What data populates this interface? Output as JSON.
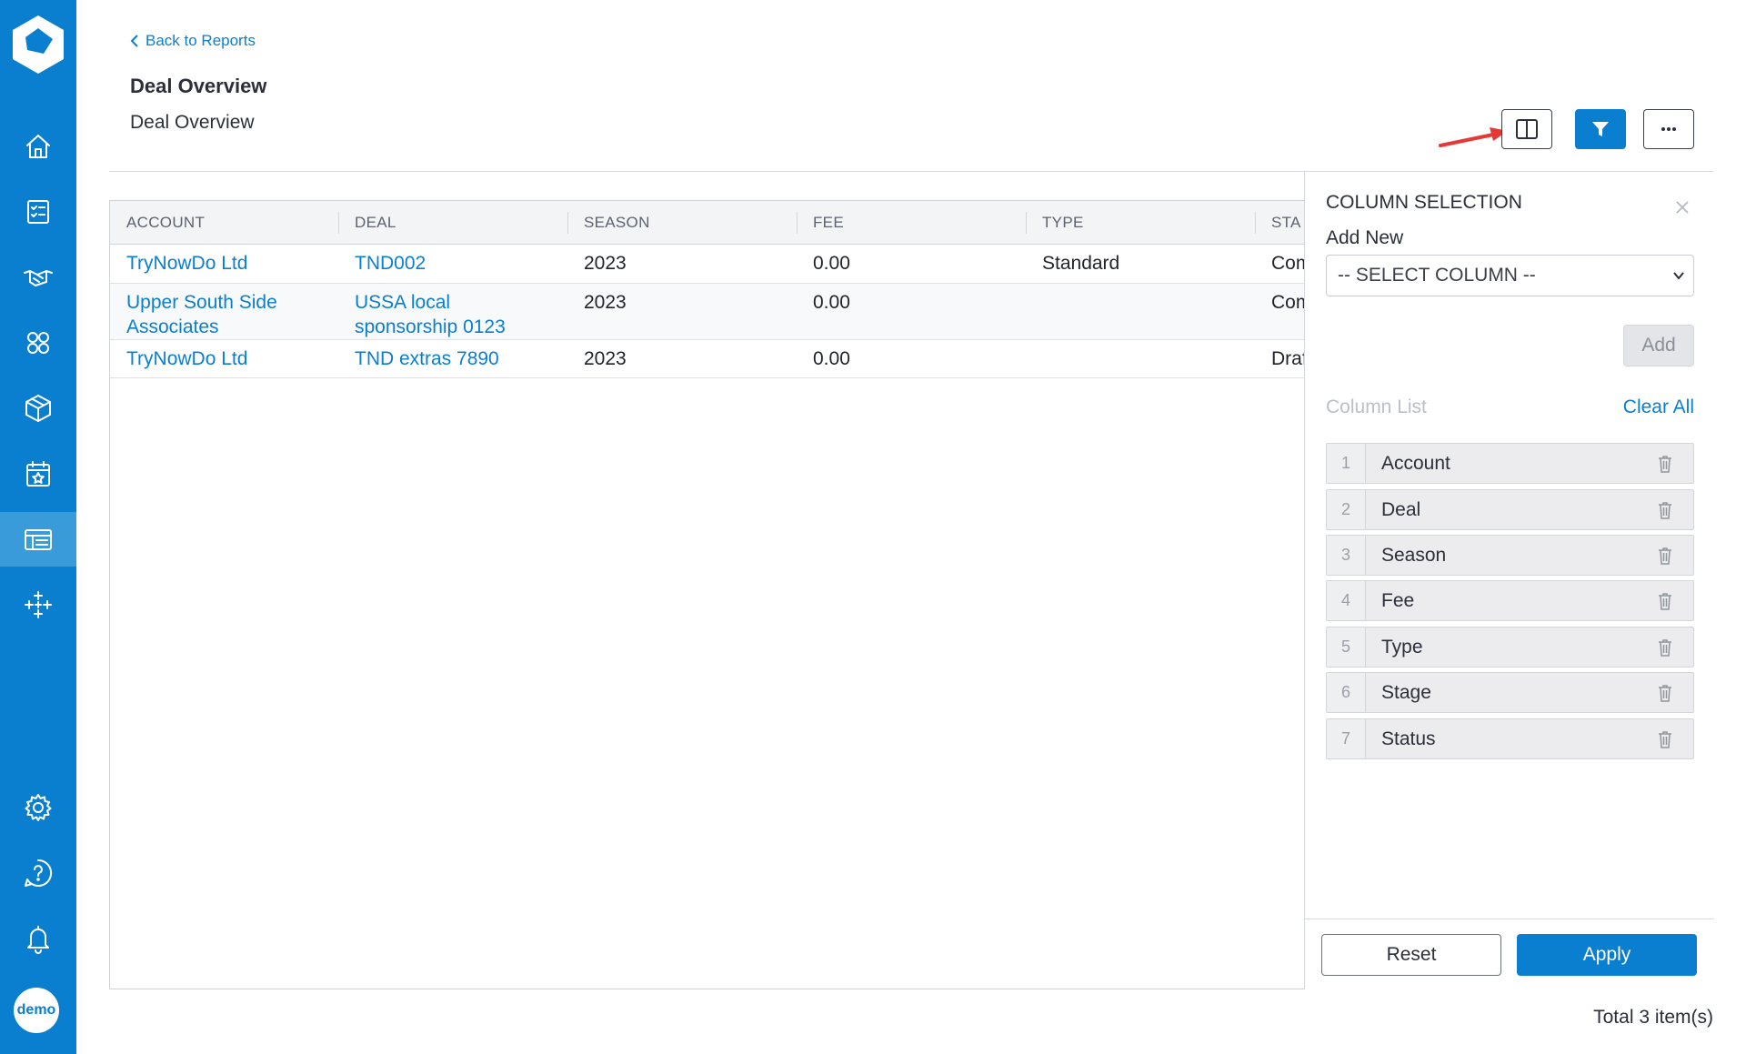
{
  "nav": {
    "items": [
      {
        "icon": "home-icon"
      },
      {
        "icon": "checklist-icon"
      },
      {
        "icon": "handshake-icon"
      },
      {
        "icon": "users-icon"
      },
      {
        "icon": "package-icon"
      },
      {
        "icon": "calendar-star-icon"
      },
      {
        "icon": "reports-icon",
        "active": true
      },
      {
        "icon": "sparkle-grid-icon"
      },
      {
        "icon": "gear-icon"
      },
      {
        "icon": "help-icon"
      },
      {
        "icon": "bell-icon"
      }
    ],
    "avatar_label": "demo"
  },
  "header": {
    "back_label": "Back to Reports",
    "title": "Deal Overview",
    "subtitle": "Deal Overview"
  },
  "toolbar": {
    "columns_icon": "columns-icon",
    "filter_icon": "filter-icon",
    "more_icon": "more-icon"
  },
  "table": {
    "columns": [
      "ACCOUNT",
      "DEAL",
      "SEASON",
      "FEE",
      "TYPE",
      "STA"
    ],
    "rows": [
      {
        "account": "TryNowDo Ltd",
        "deal": "TND002",
        "season": "2023",
        "fee": "0.00",
        "type": "Standard",
        "stage": "Com"
      },
      {
        "account": "Upper South Side Associates",
        "deal": "USSA local sponsorship 0123",
        "season": "2023",
        "fee": "0.00",
        "type": "",
        "stage": "Com"
      },
      {
        "account": "TryNowDo Ltd",
        "deal": "TND extras 7890",
        "season": "2023",
        "fee": "0.00",
        "type": "",
        "stage": "Draf"
      }
    ]
  },
  "panel": {
    "title": "COLUMN SELECTION",
    "add_new_label": "Add New",
    "select_value": "-- SELECT COLUMN --",
    "add_button": "Add",
    "column_list_label": "Column List",
    "clear_all": "Clear All",
    "columns": [
      {
        "num": "1",
        "label": "Account"
      },
      {
        "num": "2",
        "label": "Deal"
      },
      {
        "num": "3",
        "label": "Season"
      },
      {
        "num": "4",
        "label": "Fee"
      },
      {
        "num": "5",
        "label": "Type"
      },
      {
        "num": "6",
        "label": "Stage"
      },
      {
        "num": "7",
        "label": "Status"
      }
    ],
    "reset_button": "Reset",
    "apply_button": "Apply"
  },
  "footer": {
    "total": "Total 3 item(s)"
  },
  "colors": {
    "brand": "#0a7fcf",
    "sidebar_active": "#3a9bdb",
    "annotation_arrow": "#e53935"
  }
}
